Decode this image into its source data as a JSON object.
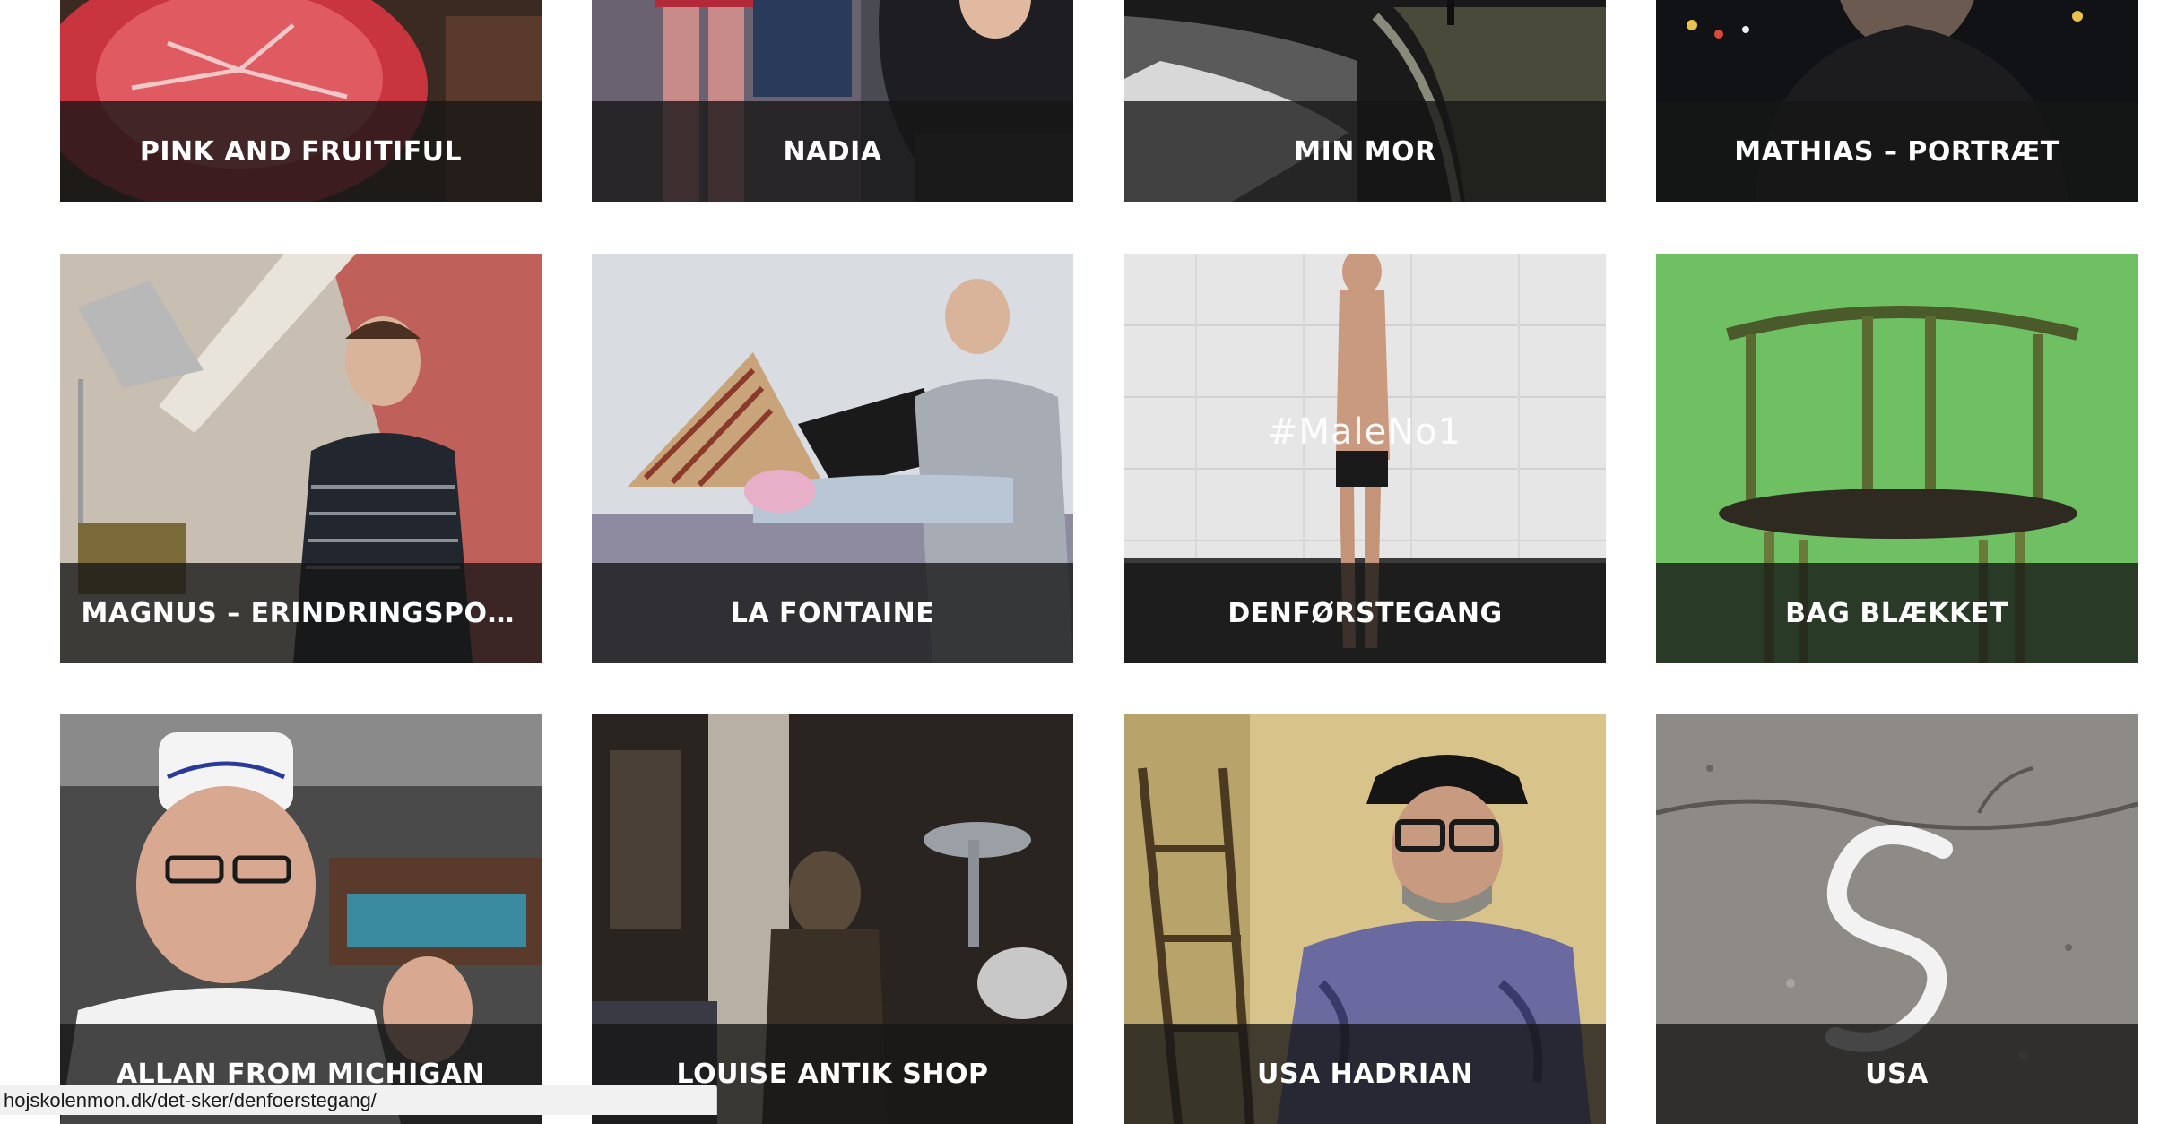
{
  "tiles": [
    {
      "title": "PINK AND FRUITIFUL",
      "scene": "grapefruit-closeup"
    },
    {
      "title": "NADIA",
      "scene": "woman-dark-room"
    },
    {
      "title": "MIN MOR",
      "scene": "shoreline-night"
    },
    {
      "title": "MATHIAS – PORTRÆT",
      "scene": "man-street-night"
    },
    {
      "title": "MAGNUS – ERINDRINGSPORT...",
      "scene": "young-man-attic"
    },
    {
      "title": "LA FONTAINE",
      "scene": "woman-laptop-bed"
    },
    {
      "title": "DENFØRSTEGANG",
      "scene": "man-standing-white-wall",
      "overlay": "#MaleNo1"
    },
    {
      "title": "BAG BLÆKKET",
      "scene": "chair-green-screen"
    },
    {
      "title": "ALLAN FROM MICHIGAN",
      "scene": "chef-restaurant"
    },
    {
      "title": "LOUISE ANTIK SHOP",
      "scene": "antique-shop"
    },
    {
      "title": "USA HADRIAN",
      "scene": "man-cap-glasses"
    },
    {
      "title": "USA",
      "scene": "chalk-on-asphalt"
    }
  ],
  "status_bar": {
    "url": "hojskolenmon.dk/det-sker/denfoerstegang/"
  }
}
